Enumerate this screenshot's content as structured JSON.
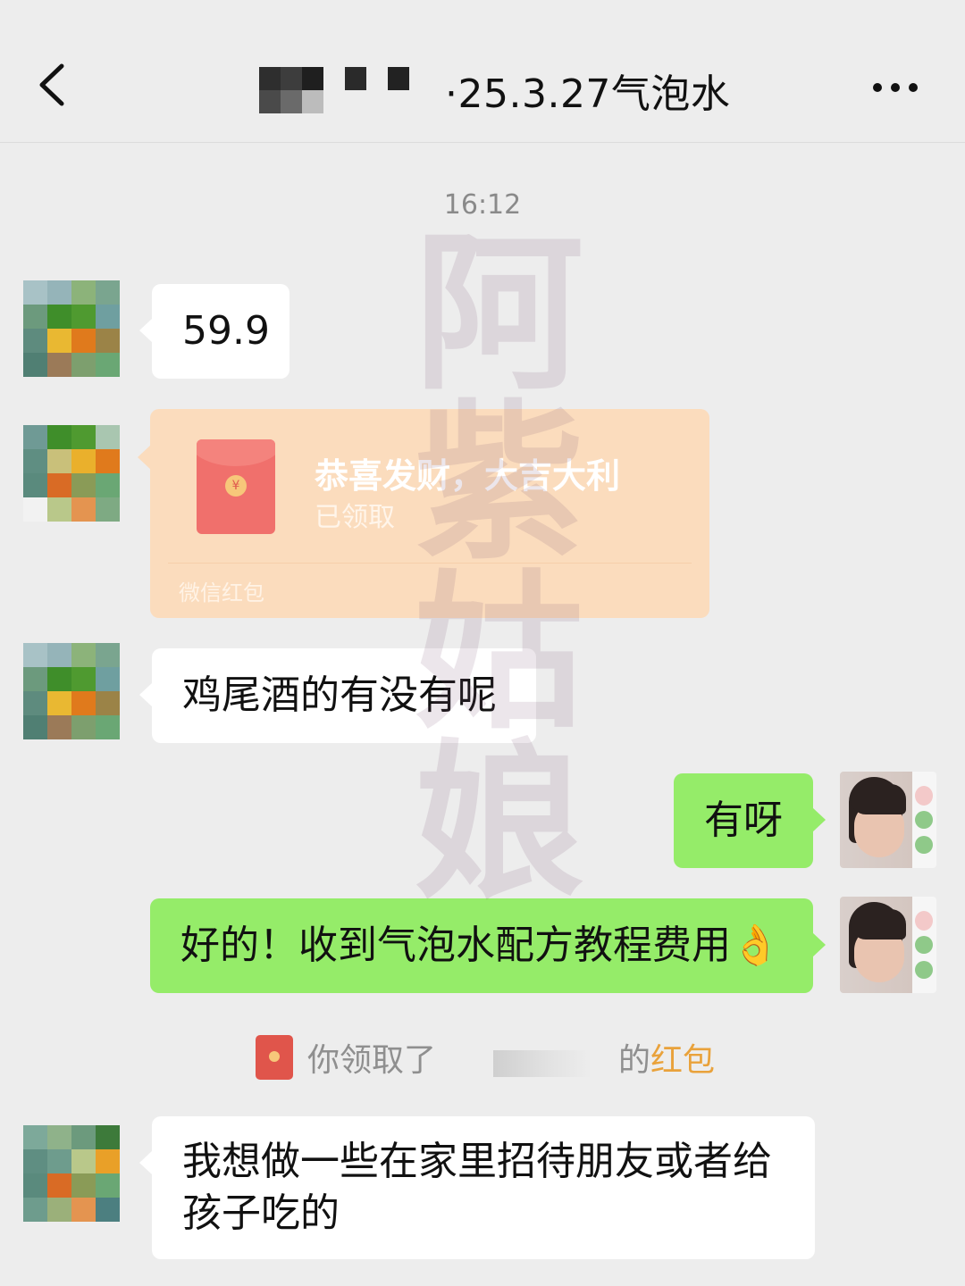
{
  "header": {
    "title": "·25.3.27气泡水"
  },
  "chat": {
    "timestamp": "16:12",
    "messages": [
      {
        "side": "left",
        "text": "59.9"
      },
      {
        "side": "left",
        "type": "red-packet",
        "title": "恭喜发财，大吉大利",
        "status": "已领取",
        "footer": "微信红包"
      },
      {
        "side": "left",
        "text": "鸡尾酒的有没有呢"
      },
      {
        "side": "right",
        "text": "有呀"
      },
      {
        "side": "right",
        "text": "好的！收到气泡水配方教程费用👌"
      },
      {
        "side": "left",
        "text_line1": "我想做一些在家里招待朋友或者给",
        "text_line2": "孩子吃的"
      }
    ],
    "system": {
      "prefix": "你领取了",
      "suffix": "的",
      "link": "红包"
    }
  },
  "watermark": {
    "text": "阿紫姑娘"
  },
  "colors": {
    "background": "#ededed",
    "bubble_left": "#ffffff",
    "bubble_right": "#95ec69",
    "red_packet": "#fbdcbd",
    "link": "#e9a23b"
  },
  "icons": {
    "back": "chevron-left-icon",
    "more": "more-dots-icon",
    "red_packet": "red-packet-icon"
  }
}
